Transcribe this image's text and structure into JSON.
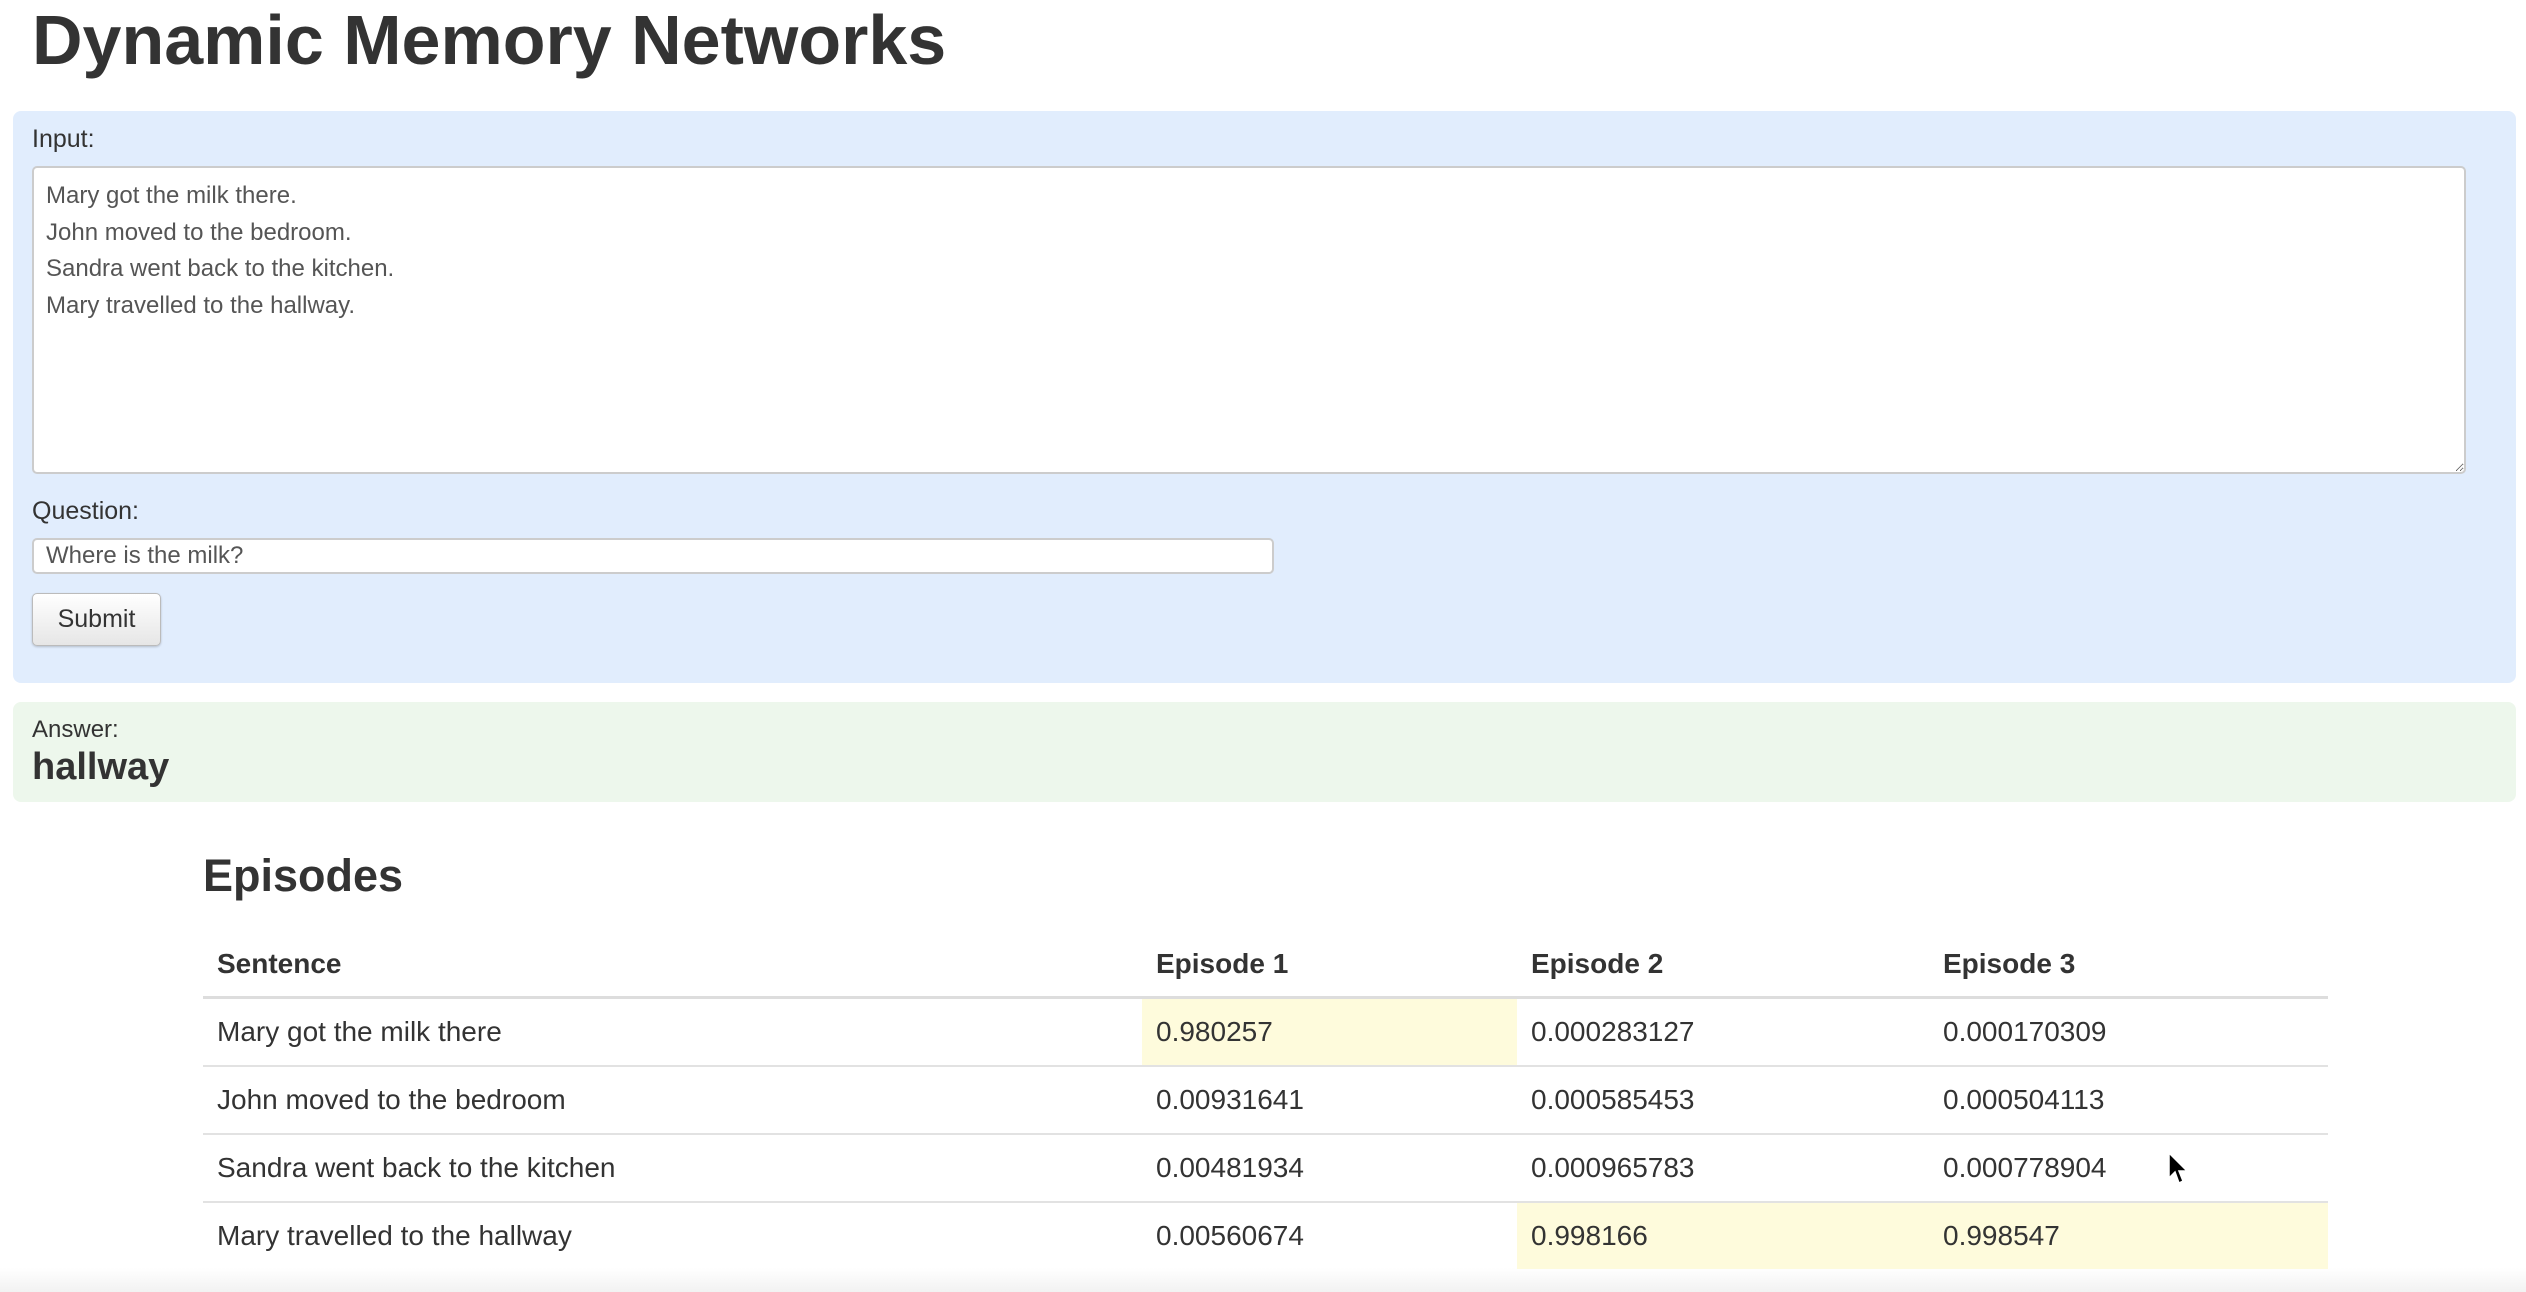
{
  "title": "Dynamic Memory Networks",
  "form": {
    "input_label": "Input:",
    "input_value": "Mary got the milk there.\nJohn moved to the bedroom.\nSandra went back to the kitchen.\nMary travelled to the hallway.",
    "question_label": "Question:",
    "question_value": "Where is the milk?",
    "submit_label": "Submit"
  },
  "answer": {
    "label": "Answer:",
    "value": "hallway"
  },
  "episodes": {
    "title": "Episodes",
    "headers": [
      "Sentence",
      "Episode 1",
      "Episode 2",
      "Episode 3"
    ],
    "rows": [
      {
        "cells": [
          "Mary got the milk there",
          "0.980257",
          "0.000283127",
          "0.000170309"
        ],
        "highlight": [
          false,
          true,
          false,
          false
        ]
      },
      {
        "cells": [
          "John moved to the bedroom",
          "0.00931641",
          "0.000585453",
          "0.000504113"
        ],
        "highlight": [
          false,
          false,
          false,
          false
        ]
      },
      {
        "cells": [
          "Sandra went back to the kitchen",
          "0.00481934",
          "0.000965783",
          "0.000778904"
        ],
        "highlight": [
          false,
          false,
          false,
          false
        ]
      },
      {
        "cells": [
          "Mary travelled to the hallway",
          "0.00560674",
          "0.998166",
          "0.998547"
        ],
        "highlight": [
          false,
          false,
          true,
          true
        ]
      }
    ]
  },
  "colors": {
    "form_bg": "#e1edfd",
    "answer_bg": "#edf7ec",
    "highlight": "#fefbdc"
  }
}
